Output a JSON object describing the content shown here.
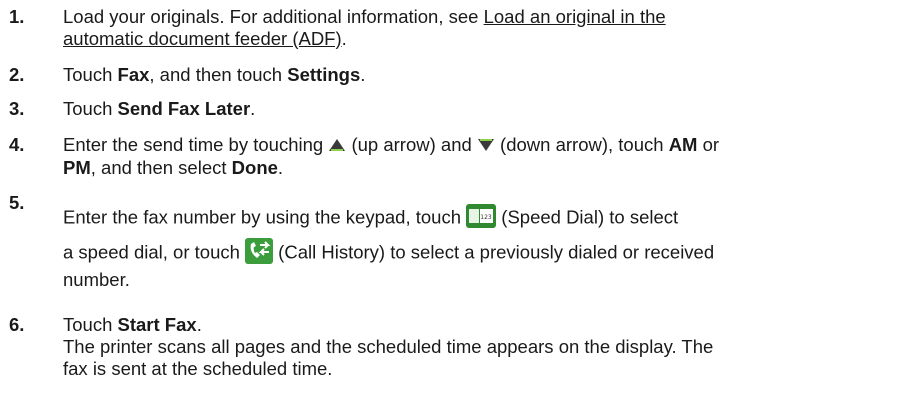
{
  "steps": [
    {
      "num": "1.",
      "line1": "Load your originals. For additional information, see ",
      "link_line1": "Load an original in the",
      "link_line2": "automatic document feeder (ADF)",
      "tail": "."
    },
    {
      "num": "2.",
      "t1": "Touch ",
      "b1": "Fax",
      "t2": ", and then touch ",
      "b2": "Settings",
      "t3": "."
    },
    {
      "num": "3.",
      "t1": "Touch ",
      "b1": "Send Fax Later",
      "t2": "."
    },
    {
      "num": "4.",
      "t1": "Enter the send time by touching ",
      "t2": " (up arrow) and ",
      "t3": " (down arrow), touch ",
      "b1": "AM",
      "t4": " or",
      "b2": "PM",
      "t5": ", and then select ",
      "b3": "Done",
      "t6": "."
    },
    {
      "num": "5.",
      "l1a": "Enter the fax number by using the keypad, touch ",
      "l1b": " (Speed Dial) to select",
      "l2a": "a speed dial, or touch ",
      "l2b": " (Call History) to select a previously dialed or received",
      "l3": "number."
    },
    {
      "num": "6.",
      "t1": "Touch ",
      "b1": "Start Fax",
      "t2": ".",
      "note1": "The printer scans all pages and the scheduled time appears on the display. The",
      "note2": "fax is sent at the scheduled time."
    }
  ],
  "icons": {
    "up": "up-arrow-icon",
    "down": "down-arrow-icon",
    "speed_dial": "speed-dial-icon",
    "call_history": "call-history-icon"
  }
}
